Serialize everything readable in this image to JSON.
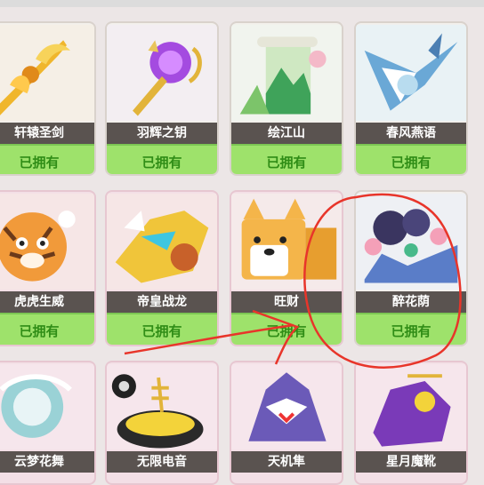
{
  "items": [
    {
      "name": "轩辕圣剑",
      "status": "已拥有",
      "icon": "golden-sword-icon"
    },
    {
      "name": "羽辉之钥",
      "status": "已拥有",
      "icon": "purple-key-icon"
    },
    {
      "name": "绘江山",
      "status": "已拥有",
      "icon": "scroll-landscape-icon"
    },
    {
      "name": "春风燕语",
      "status": "已拥有",
      "icon": "swallow-bird-icon"
    },
    {
      "name": "虎虎生威",
      "status": "已拥有",
      "icon": "tiger-icon"
    },
    {
      "name": "帝皇战龙",
      "status": "已拥有",
      "icon": "war-dragon-icon"
    },
    {
      "name": "旺财",
      "status": "已拥有",
      "icon": "shiba-dog-icon"
    },
    {
      "name": "醉花荫",
      "status": "已拥有",
      "icon": "flower-tree-icon"
    },
    {
      "name": "云梦花舞",
      "status": "",
      "icon": "cloud-dragon-icon"
    },
    {
      "name": "无限电音",
      "status": "",
      "icon": "speaker-icon"
    },
    {
      "name": "天机隼",
      "status": "",
      "icon": "mech-falcon-icon"
    },
    {
      "name": "星月魔靴",
      "status": "",
      "icon": "purple-boot-icon"
    }
  ],
  "colors": {
    "owned_bg": "#9ee26b",
    "owned_text": "#2f8d16",
    "name_bar": "#5a5350",
    "annotation": "#e8352a"
  }
}
